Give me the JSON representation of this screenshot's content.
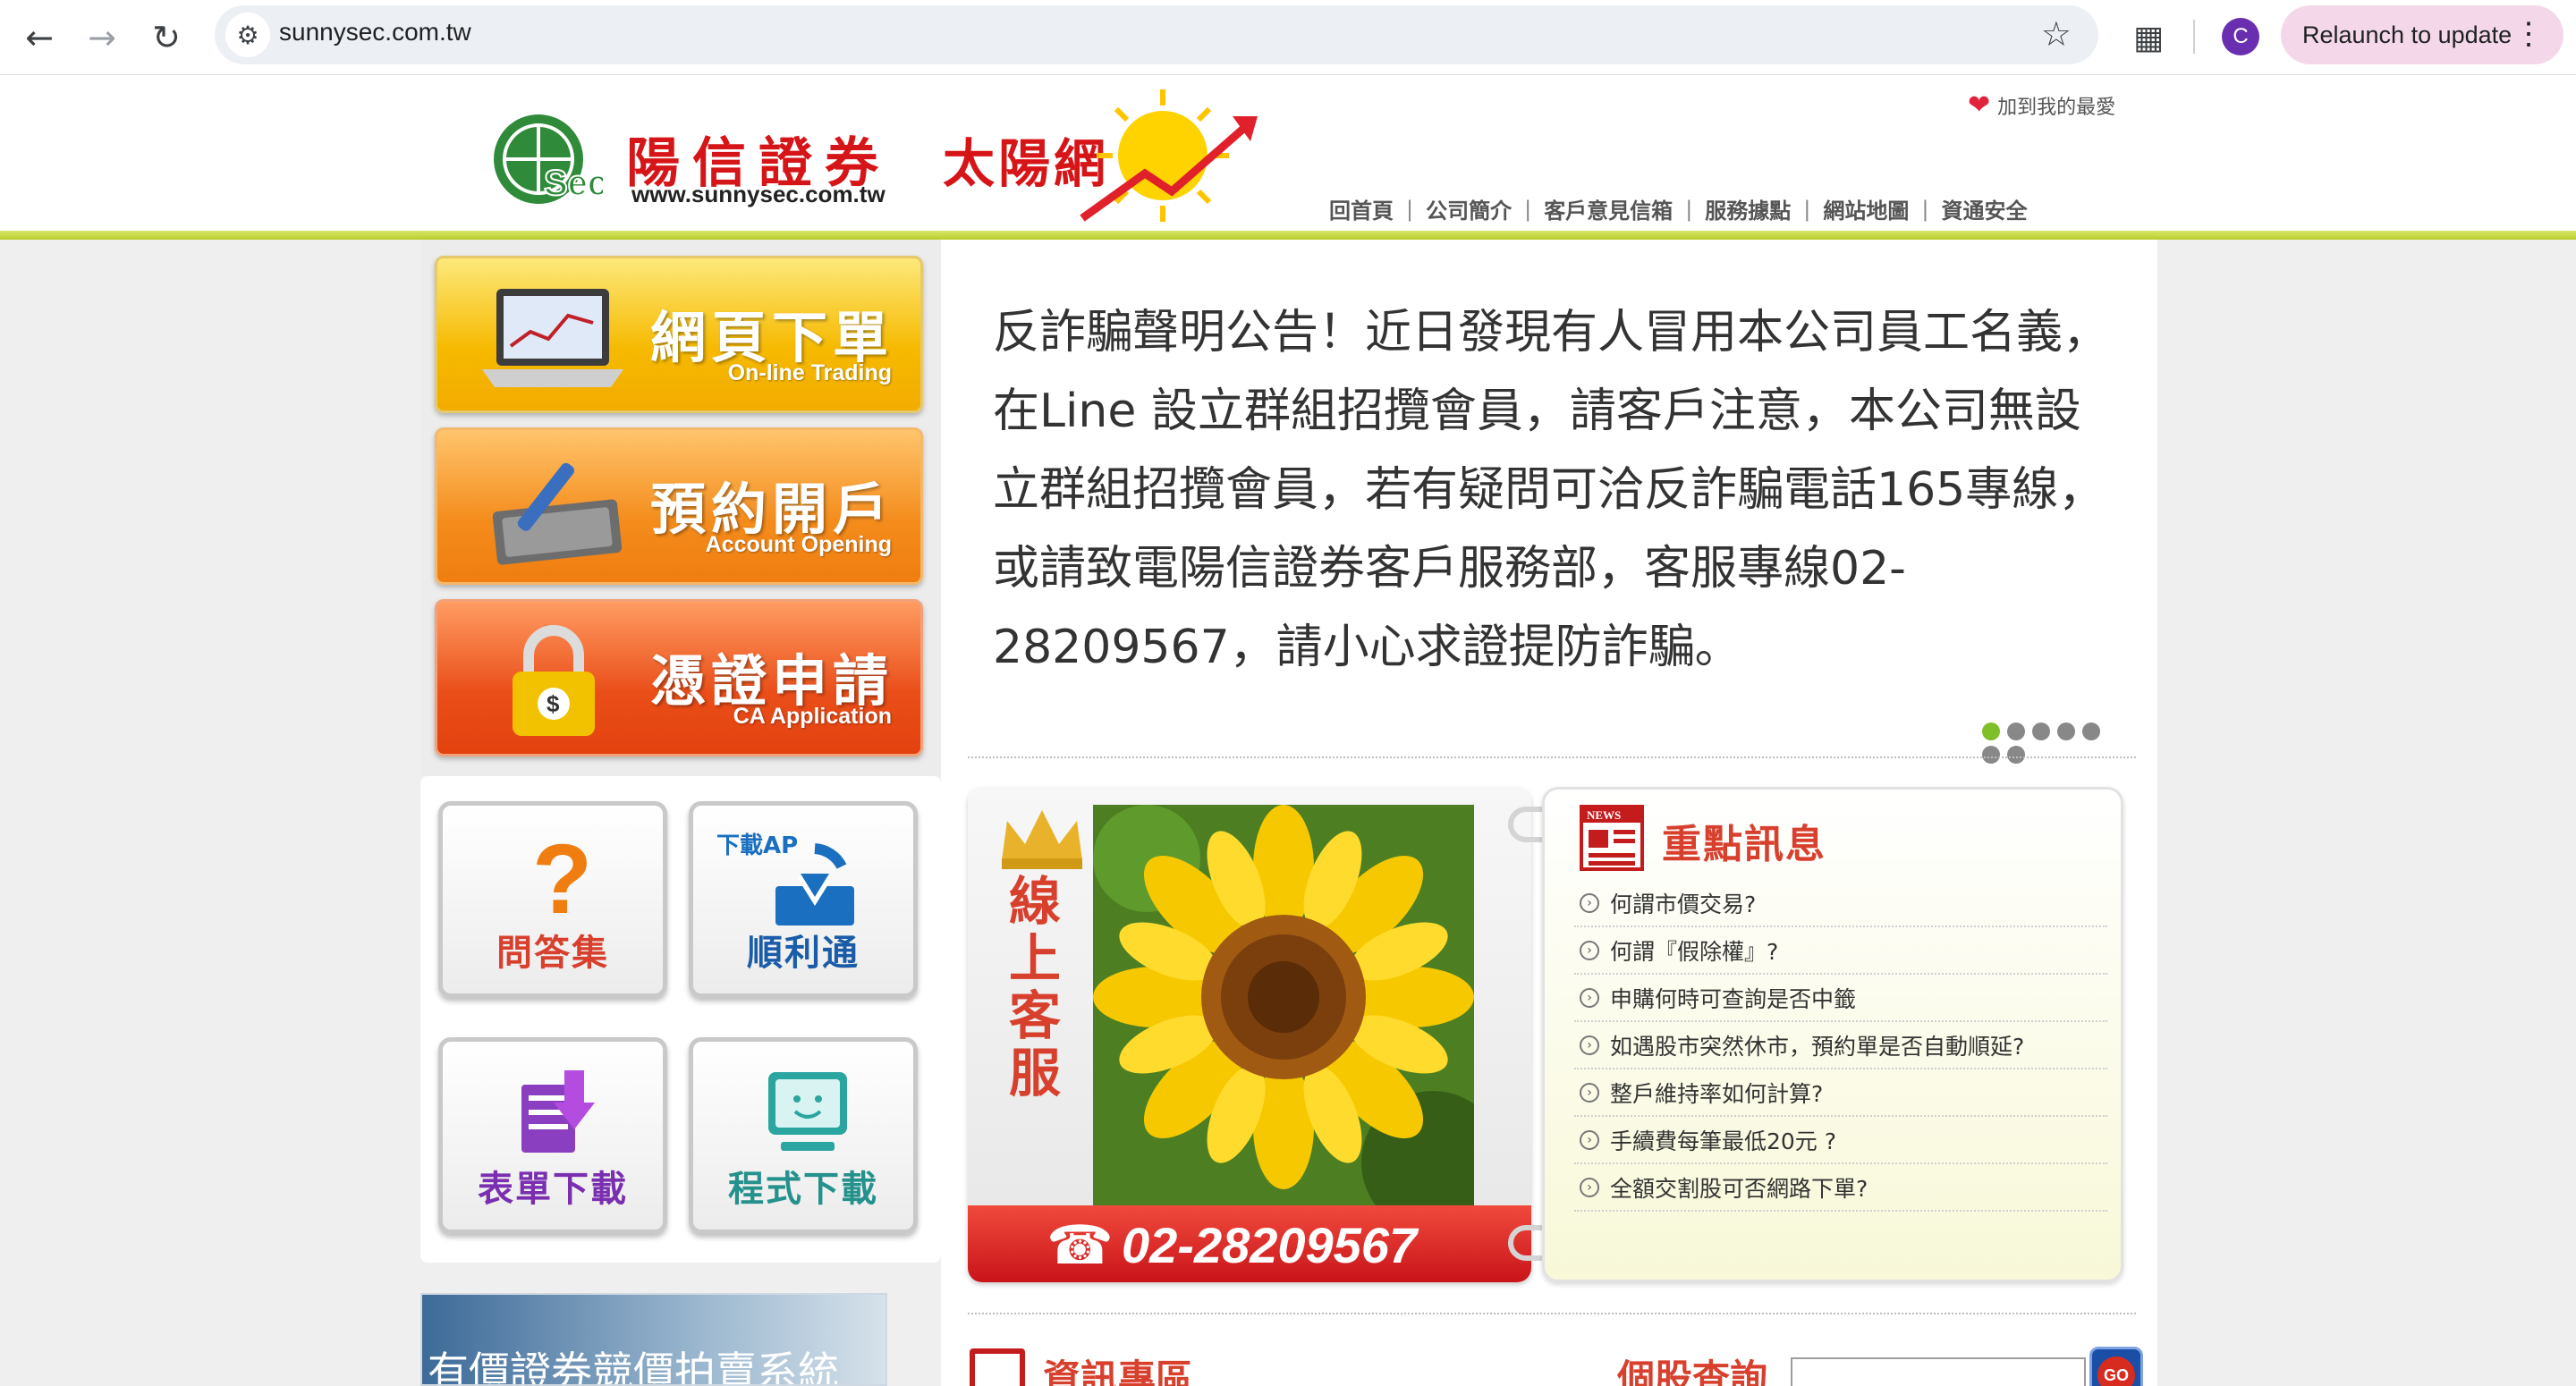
{
  "browser": {
    "url": "sunnysec.com.tw",
    "relaunch_label": "Relaunch to update",
    "profile_initial": "C"
  },
  "header": {
    "brand_name": "陽信證券",
    "brand_url": "www.sunnysec.com.tw",
    "sun_net": "太陽網",
    "favorite_label": "加到我的最愛",
    "nav": [
      "回首頁",
      "公司簡介",
      "客戶意見信箱",
      "服務據點",
      "網站地圖",
      "資通安全"
    ]
  },
  "left_buttons": {
    "trade": {
      "zh": "網頁下單",
      "en": "On-line Trading"
    },
    "open": {
      "zh": "預約開戶",
      "en": "Account Opening"
    },
    "ca": {
      "zh": "憑證申請",
      "en": "CA Application"
    }
  },
  "tiles": {
    "faq": "問答集",
    "app_tag": "下載AP",
    "app": "順利通",
    "form": "表單下載",
    "program": "程式下載"
  },
  "bottom_banner": "有價證券競價拍賣系統",
  "announcement": "反詐騙聲明公告！近日發現有人冒用本公司員工名義，在Line 設立群組招攬會員，請客戶注意，本公司無設立群組招攬會員，若有疑問可洽反詐騙電話165專線，或請致電陽信證券客戶服務部，客服專線02-28209567，請小心求證提防詐騙。",
  "customer_service": {
    "label": "線上客服",
    "phone": "02-28209567"
  },
  "news": {
    "title": "重點訊息",
    "items": [
      "何謂市價交易?",
      "何謂『假除權』?",
      "申購何時可查詢是否中籤",
      "如遇股市突然休市，預約單是否自動順延?",
      "整戶維持率如何計算?",
      "手續費每筆最低20元 ?",
      "全額交割股可否網路下單?"
    ]
  },
  "bottom": {
    "info_title": "資訊專區",
    "stock_title": "個股查詢",
    "go_label": "GO"
  },
  "colors": {
    "brand_red": "#d61518",
    "accent_red": "#d8402e",
    "header_line": "#b7cc2c"
  }
}
